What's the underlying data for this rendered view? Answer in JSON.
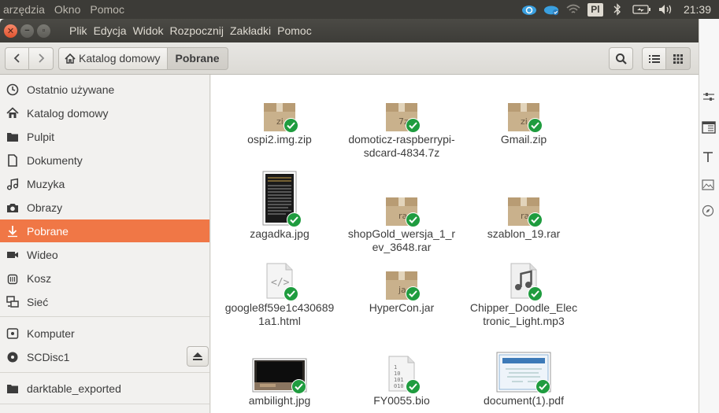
{
  "top_panel": {
    "menus": [
      "arzędzia",
      "Okno",
      "Pomoc"
    ],
    "clock": "21:39",
    "keyboard_layout": "Pl",
    "icons": [
      "cloud-sync-icon",
      "cloud-sync-icon",
      "wifi-icon",
      "keyboard-layout-icon",
      "bluetooth-icon",
      "battery-icon",
      "volume-icon"
    ]
  },
  "window": {
    "menus": [
      "Plik",
      "Edycja",
      "Widok",
      "Rozpocznij",
      "Zakładki",
      "Pomoc"
    ]
  },
  "toolbar": {
    "path": [
      "Katalog domowy",
      "Pobrane"
    ]
  },
  "sidebar": {
    "items": [
      {
        "label": "Ostatnio używane",
        "icon": "clock-icon"
      },
      {
        "label": "Katalog domowy",
        "icon": "home-icon"
      },
      {
        "label": "Pulpit",
        "icon": "folder-icon"
      },
      {
        "label": "Dokumenty",
        "icon": "document-icon"
      },
      {
        "label": "Muzyka",
        "icon": "music-icon"
      },
      {
        "label": "Obrazy",
        "icon": "camera-icon"
      },
      {
        "label": "Pobrane",
        "icon": "download-icon",
        "active": true
      },
      {
        "label": "Wideo",
        "icon": "video-icon"
      },
      {
        "label": "Kosz",
        "icon": "trash-icon"
      },
      {
        "label": "Sieć",
        "icon": "network-icon"
      },
      {
        "label": "Komputer",
        "icon": "computer-icon"
      },
      {
        "label": "SCDisc1",
        "icon": "disc-icon"
      },
      {
        "label": "darktable_exported",
        "icon": "folder-icon"
      }
    ]
  },
  "files": [
    {
      "name": "ospi2.img.zip",
      "type": "archive",
      "badge": "zi"
    },
    {
      "name": "domoticz-raspberrypi-sdcard-4834.7z",
      "type": "archive",
      "badge": "7z"
    },
    {
      "name": "Gmail.zip",
      "type": "archive",
      "badge": "zi"
    },
    {
      "name": "zagadka.jpg",
      "type": "image-doc"
    },
    {
      "name": "shopGold_wersja_1_rev_3648.rar",
      "type": "archive",
      "badge": "ra"
    },
    {
      "name": "szablon_19.rar",
      "type": "archive",
      "badge": "ra"
    },
    {
      "name": "google8f59e1c4306891a1.html",
      "type": "html"
    },
    {
      "name": "HyperCon.jar",
      "type": "archive",
      "badge": "ja"
    },
    {
      "name": "Chipper_Doodle_Electronic_Light.mp3",
      "type": "audio"
    },
    {
      "name": "ambilight.jpg",
      "type": "photo"
    },
    {
      "name": "FY0055.bio",
      "type": "binary"
    },
    {
      "name": "document(1).pdf",
      "type": "pdf"
    }
  ]
}
